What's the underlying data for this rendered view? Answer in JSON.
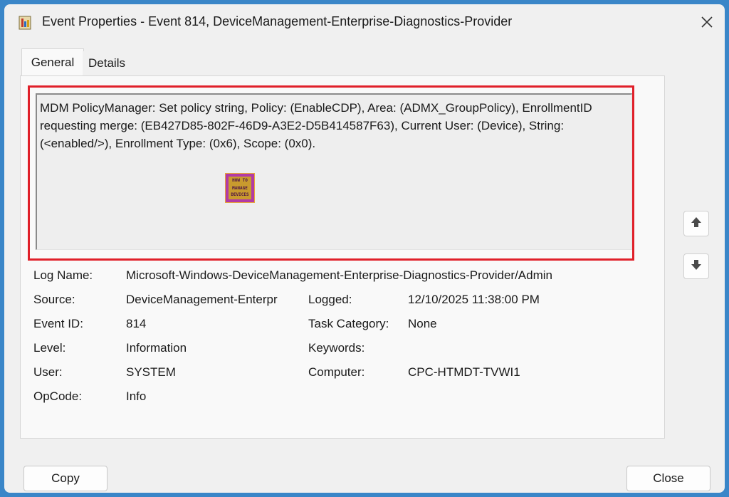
{
  "window": {
    "title": "Event Properties - Event 814, DeviceManagement-Enterprise-Diagnostics-Provider"
  },
  "tabs": [
    {
      "label": "General"
    },
    {
      "label": "Details"
    }
  ],
  "message": "MDM PolicyManager: Set policy string, Policy: (EnableCDP), Area: (ADMX_GroupPolicy), EnrollmentID requesting merge: (EB427D85-802F-46D9-A3E2-D5B414587F63), Current User: (Device), String: (<enabled/>), Enrollment Type: (0x6), Scope: (0x0).",
  "watermark": {
    "line1": "HOW TO",
    "line2": "MANAGE",
    "line3": "DEVICES"
  },
  "fields": {
    "log_name_label": "Log Name:",
    "log_name_value": "Microsoft-Windows-DeviceManagement-Enterprise-Diagnostics-Provider/Admin",
    "source_label": "Source:",
    "source_value": "DeviceManagement-Enterpr",
    "logged_label": "Logged:",
    "logged_value": "12/10/2025 11:38:00 PM",
    "event_id_label": "Event ID:",
    "event_id_value": "814",
    "task_category_label": "Task Category:",
    "task_category_value": "None",
    "level_label": "Level:",
    "level_value": "Information",
    "keywords_label": "Keywords:",
    "keywords_value": "",
    "user_label": "User:",
    "user_value": "SYSTEM",
    "computer_label": "Computer:",
    "computer_value": "CPC-HTMDT-TVWI1",
    "opcode_label": "OpCode:",
    "opcode_value": "Info"
  },
  "buttons": {
    "copy": "Copy",
    "close": "Close"
  },
  "icons": {
    "title": "event-viewer-icon",
    "close": "close-icon",
    "up": "arrow-up-icon",
    "down": "arrow-down-icon"
  },
  "colors": {
    "background": "#3a86c8",
    "highlight": "#e0202a"
  }
}
